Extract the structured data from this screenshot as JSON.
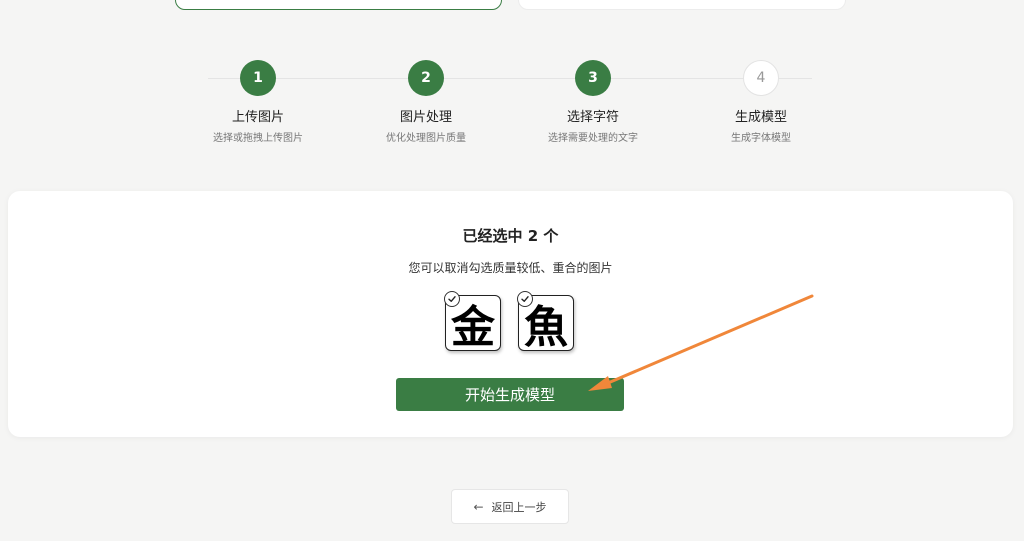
{
  "steps": [
    {
      "number": "1",
      "title": "上传图片",
      "desc": "选择或拖拽上传图片",
      "state": "done"
    },
    {
      "number": "2",
      "title": "图片处理",
      "desc": "优化处理图片质量",
      "state": "done"
    },
    {
      "number": "3",
      "title": "选择字符",
      "desc": "选择需要处理的文字",
      "state": "active"
    },
    {
      "number": "4",
      "title": "生成模型",
      "desc": "生成字体模型",
      "state": "pending"
    }
  ],
  "selection": {
    "heading": "已经选中 2 个",
    "hint": "您可以取消勾选质量较低、重合的图片",
    "items": [
      {
        "glyph": "金",
        "checked": true
      },
      {
        "glyph": "魚",
        "checked": true
      }
    ]
  },
  "actions": {
    "generate_label": "开始生成模型",
    "back_label": "返回上一步"
  },
  "colors": {
    "accent": "#3a7d44",
    "annotation_arrow": "#f0873a"
  }
}
